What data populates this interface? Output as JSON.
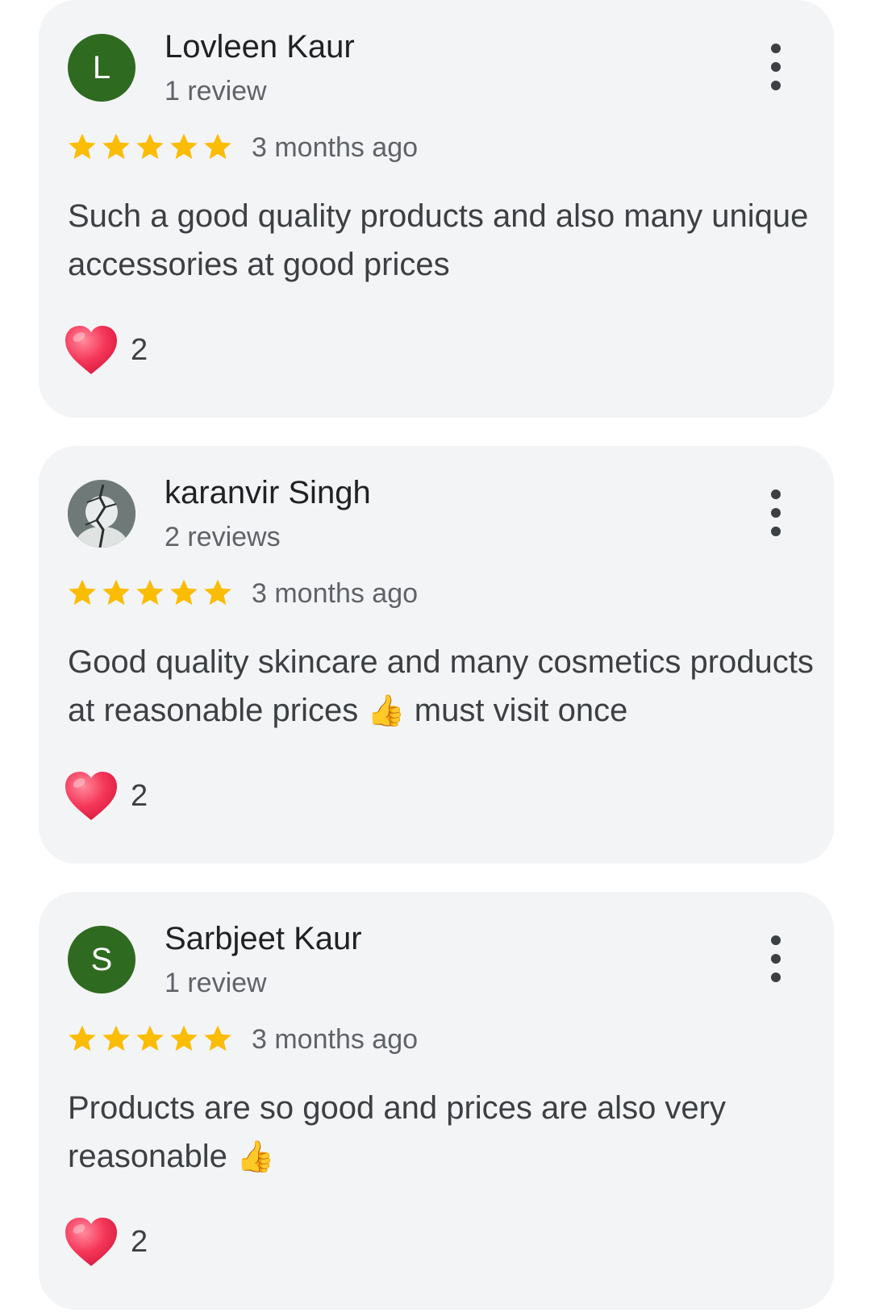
{
  "reviews": [
    {
      "avatar_letter": "L",
      "avatar_color": "#2e6a1f",
      "name": "Lovleen Kaur",
      "review_count": "1 review",
      "rating": 5,
      "time": "3 months ago",
      "text": "Such a good quality products and also many unique accessories at good prices",
      "reaction_icon": "heart-icon",
      "reaction_count": "2"
    },
    {
      "avatar_letter": "",
      "avatar_color": "#6f7a78",
      "name": "karanvir Singh",
      "review_count": "2 reviews",
      "rating": 5,
      "time": "3 months ago",
      "text": "Good quality skincare and many cosmetics products at reasonable prices",
      "text_suffix": "must visit once",
      "text_emoji": "👍",
      "reaction_icon": "heart-icon",
      "reaction_count": "2"
    },
    {
      "avatar_letter": "S",
      "avatar_color": "#2e6a1f",
      "name": "Sarbjeet Kaur",
      "review_count": "1 review",
      "rating": 5,
      "time": "3 months ago",
      "text": "Products are so good and prices are also very reasonable",
      "text_emoji": "👍",
      "reaction_icon": "heart-icon",
      "reaction_count": "2"
    }
  ],
  "colors": {
    "star": "#fbbc04",
    "card_background": "#f3f4f6",
    "heart": "#f0344f"
  }
}
